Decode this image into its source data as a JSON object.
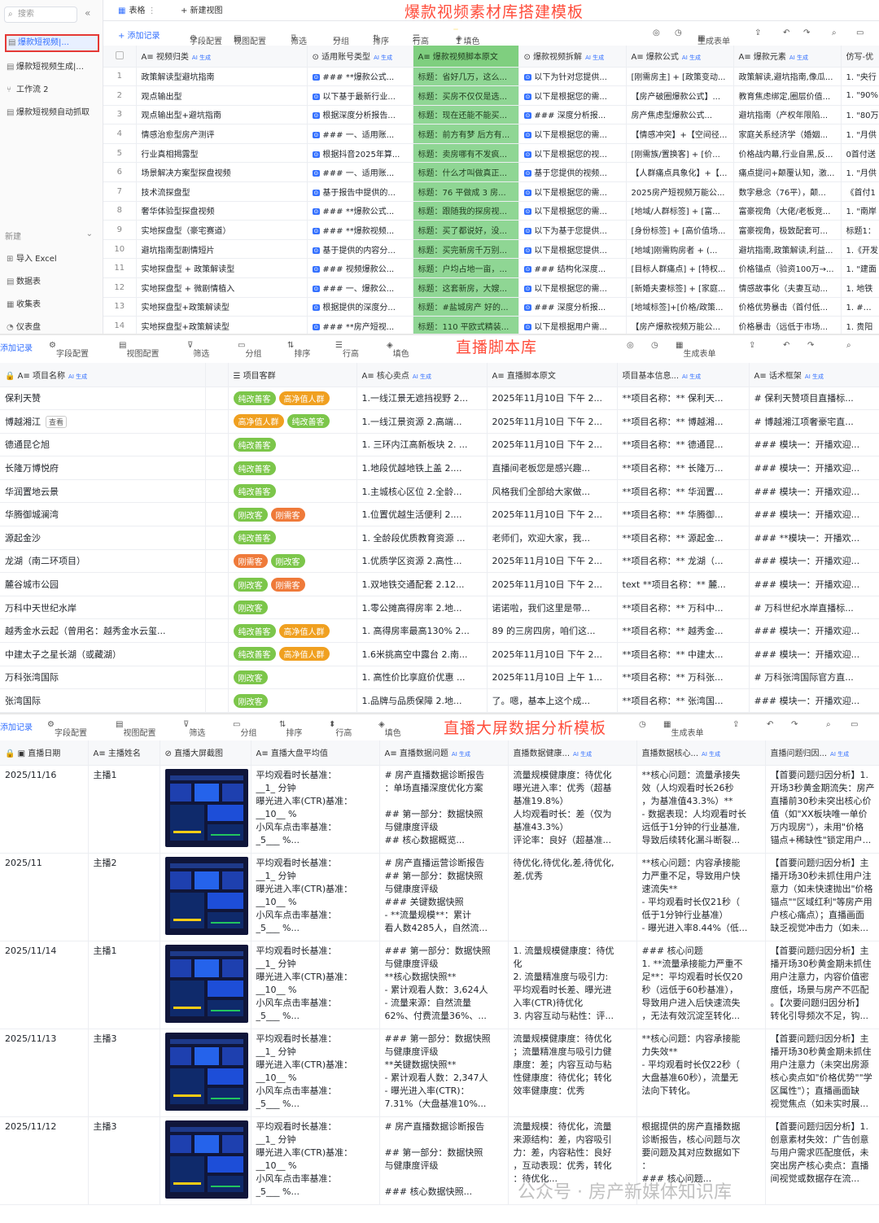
{
  "sidebar": {
    "search_placeholder": "搜索",
    "items": [
      "爆款短视频|...",
      "爆款短视频生成|...",
      "工作流 2",
      "爆款短视频自动抓取"
    ],
    "new_label": "新建",
    "actions": [
      "导入 Excel",
      "数据表",
      "收集表",
      "仪表盘"
    ]
  },
  "section1": {
    "title": "爆款视频素材库搭建模板",
    "tabs": [
      "表格",
      "+ 新建视图"
    ],
    "toolbar": [
      "+ 添加记录",
      "字段配置",
      "视图配置",
      "筛选",
      "分组",
      "排序",
      "行高",
      "1 填色",
      "生成表单"
    ],
    "headers": [
      "视频归类",
      "适用账号类型",
      "爆款视频脚本原文",
      "爆款视频拆解",
      "爆款公式",
      "爆款元素",
      "仿写-优"
    ],
    "rows": [
      [
        "1",
        "政策解读型避坑指南",
        "### **爆款公式...",
        "标题：省好几万，这么...",
        "以下为针对您提供...",
        "[刚需房主] + [政策变动...",
        "政策解读,避坑指南,像瓜...",
        "1. \"央行"
      ],
      [
        "2",
        "观点输出型",
        "以下基于最新行业...",
        "标题：买房不仅仅是选...",
        "以下是根据您的需...",
        "【房产破圈爆款公式】...",
        "教育焦虑绑定,圈层价值...",
        "1. \"90%"
      ],
      [
        "3",
        "观点输出型+避坑指南",
        "根据深度分析报告...",
        "标题：现在还能不能买...",
        "### 深度分析报...",
        "房产焦虑型爆款公式...",
        "避坑指南（产权年限陷...",
        "1. \"80万"
      ],
      [
        "4",
        "情感治愈型房产测评",
        "### 一、适用账...",
        "标题：前方有梦 后方有...",
        "以下是根据您的需...",
        "【情感冲突】+【空间径...",
        "家庭关系经济学（婚姻...",
        "1. \"月供"
      ],
      [
        "5",
        "行业真相揭露型",
        "根据抖音2025年算...",
        "标题：卖房哪有不发疯...",
        "以下是根据您的视...",
        "[刚需族/置换客] + [价...",
        "价格战内幕,行业自黑,反...",
        "0首付送"
      ],
      [
        "6",
        "场景解决方案型探盘视频",
        "### 一、适用账...",
        "标题：什么才叫做真正...",
        "基于您提供的视频...",
        "【人群痛点具象化】+【...",
        "痛点提问+颠覆认知，激...",
        "1. \"月供"
      ],
      [
        "7",
        "技术流探盘型",
        "基于报告中提供的...",
        "标题：76 平做成 3 房...",
        "以下是根据您的需...",
        "2025房产短视频万能公...",
        "数字悬念（76平），颠...",
        "《首付1"
      ],
      [
        "8",
        "奢华体验型探盘视频",
        "### **爆款公式...",
        "标题：跟随我的探房视...",
        "以下是根据您的需...",
        "[地域/人群标签] + [富...",
        "富豪视角（大佬/老板竞...",
        "1. \"南岸"
      ],
      [
        "9",
        "实地探盘型（豪宅赛道）",
        "### **爆款视频...",
        "标题：买了都说好，没...",
        "以下为基于您提供...",
        "[身份标签] + [高价值场...",
        "富豪视角，极致配套可...",
        "标题1："
      ],
      [
        "10",
        "避坑指南型剧情短片",
        "基于提供的内容分...",
        "标题：买完新房千万别...",
        "以下是根据您提供...",
        "[地域]刚需购房者 + (...",
        "避坑指南,政策解读,利益...",
        "1.《开发"
      ],
      [
        "11",
        "实地探盘型 + 政策解读型",
        "### 视频爆款公...",
        "标题：户均占地一亩，...",
        "### 结构化深度...",
        "[目标人群痛点] + [特权...",
        "价格锚点（验资100万→...",
        "1. \"建面"
      ],
      [
        "12",
        "实地探盘型 + 微剧情植入",
        "### 一、爆款公...",
        "标题：这套新房，大嫂...",
        "以下是根据您的需...",
        "[新婚夫妻标签] + [家庭...",
        "情感故事化（夫妻互动...",
        "1. 地铁"
      ],
      [
        "13",
        "实地探盘型+政策解读型",
        "根据提供的深度分...",
        "标题：#盐城房产 好的...",
        "### 深度分析报...",
        "[地域标签]+[价格/政策...",
        "价格优势暴击（首付低...",
        "1. #盐城"
      ],
      [
        "14",
        "实地探盘型+政策解读型",
        "### **房产短视...",
        "标题：110 平欧式精装...",
        "以下是根据用户需...",
        "【房产爆款视频万能公...",
        "价格暴击（远低于市场...",
        "1. 贵阳"
      ]
    ]
  },
  "section2": {
    "title": "直播脚本库",
    "toolbar": [
      "添加记录",
      "字段配置",
      "视图配置",
      "筛选",
      "分组",
      "排序",
      "行高",
      "填色",
      "生成表单"
    ],
    "headers": [
      "项目名称",
      "项目客群",
      "核心卖点",
      "直播脚本原文",
      "项目基本信息...",
      "话术框架"
    ],
    "view_label": "查看",
    "rows": [
      {
        "name": "保利天赞",
        "tags": [
          [
            "纯改善客",
            "g"
          ],
          [
            "高净值人群",
            "o"
          ]
        ],
        "point": "1.一线江景无遮挡视野 2...",
        "script": "2025年11月10日 下午 2...",
        "info": "**项目名称：** 保利天...",
        "frame": "# 保利天赞项目直播标..."
      },
      {
        "name": "博越湘江",
        "tags": [
          [
            "高净值人群",
            "o"
          ],
          [
            "纯改善客",
            "g"
          ]
        ],
        "point": "1.一线江景资源 2.高端...",
        "script": "2025年11月10日 下午 2...",
        "info": "**项目名称：** 博越湘...",
        "frame": "# 博越湘江项奢豪宅直..."
      },
      {
        "name": "德通昆仑旭",
        "tags": [
          [
            "纯改善客",
            "g"
          ]
        ],
        "point": "1. 三环内江高新板块 2. ...",
        "script": "2025年11月10日 下午 2...",
        "info": "**项目名称：** 德通昆...",
        "frame": "### 模块一：开播欢迎..."
      },
      {
        "name": "长隆万博悦府",
        "tags": [
          [
            "纯改善客",
            "g"
          ]
        ],
        "point": "1.地段优越地铁上盖 2....",
        "script": "直播间老板您是感兴趣...",
        "info": "**项目名称：** 长隆万...",
        "frame": "### 模块一：开播欢迎..."
      },
      {
        "name": "华润置地云景",
        "tags": [
          [
            "纯改善客",
            "g"
          ]
        ],
        "point": "1.主城核心区位 2.全龄...",
        "script": "风格我们全部给大家做...",
        "info": "**项目名称：** 华润置...",
        "frame": "### 模块一：开播欢迎..."
      },
      {
        "name": "华腾御城澜湾",
        "tags": [
          [
            "刚改客",
            "g"
          ],
          [
            "刚需客",
            "r"
          ]
        ],
        "point": "1.位置优越生活便利 2....",
        "script": "2025年11月10日 下午 2...",
        "info": "**项目名称：** 华腾御...",
        "frame": "### 模块一：开播欢迎..."
      },
      {
        "name": "源起金沙",
        "tags": [
          [
            "纯改善客",
            "g"
          ]
        ],
        "point": "1. 全龄段优质教育资源 ...",
        "script": "老师们，欢迎大家，我...",
        "info": "**项目名称：** 源起金...",
        "frame": "### **模块一：开播欢..."
      },
      {
        "name": "龙湖（南二环项目）",
        "tags": [
          [
            "刚需客",
            "r"
          ],
          [
            "刚改客",
            "g"
          ]
        ],
        "point": "1.优质学区资源 2.高性...",
        "script": "2025年11月10日 下午 2...",
        "info": "**项目名称：** 龙湖（...",
        "frame": "### 模块一：开播欢迎..."
      },
      {
        "name": "麓谷城市公园",
        "tags": [
          [
            "刚改客",
            "g"
          ],
          [
            "刚需客",
            "r"
          ]
        ],
        "point": "1.双地铁交通配套 2.12...",
        "script": "2025年11月10日 下午 2...",
        "info": "text **项目名称：** 麓...",
        "frame": "### 模块一：开播欢迎..."
      },
      {
        "name": "万科中天世纪水岸",
        "tags": [
          [
            "刚改客",
            "g"
          ]
        ],
        "point": "1.零公摊高得房率 2.地...",
        "script": "诺诺啦，我们这里是带...",
        "info": "**项目名称：** 万科中...",
        "frame": "# 万科世纪水岸直播标..."
      },
      {
        "name": "越秀金水云起（曾用名：越秀金水云玺...",
        "tags": [
          [
            "纯改善客",
            "g"
          ],
          [
            "高净值人群",
            "o"
          ]
        ],
        "point": "1. 高得房率最高130% 2...",
        "script": "89 的三房四房，咱们这...",
        "info": "**项目名称：** 越秀金...",
        "frame": "### 模块一：开播欢迎..."
      },
      {
        "name": "中建太子之星长湖（或藏湖）",
        "tags": [
          [
            "纯改善客",
            "g"
          ],
          [
            "高净值人群",
            "o"
          ]
        ],
        "point": "1.6米挑高空中露台 2.南...",
        "script": "2025年11月10日 下午 2...",
        "info": "**项目名称：** 中建太...",
        "frame": "### 模块一：开播欢迎..."
      },
      {
        "name": "万科张湾国际",
        "tags": [
          [
            "刚改客",
            "g"
          ]
        ],
        "point": "1. 高性价比享庭价优惠 ...",
        "script": "2025年11月10日 上午 1...",
        "info": "**项目名称：** 万科张...",
        "frame": "# 万科张湾国际官方直..."
      },
      {
        "name": "张湾国际",
        "tags": [
          [
            "刚改客",
            "g"
          ]
        ],
        "point": "1.品牌与品质保障 2.地...",
        "script": "了。嗯，基本上这个成...",
        "info": "**项目名称：** 张湾国...",
        "frame": "### 模块一：开播欢迎..."
      }
    ]
  },
  "section3": {
    "title": "直播大屏数据分析模板",
    "toolbar": [
      "添加记录",
      "字段配置",
      "视图配置",
      "筛选",
      "分组",
      "排序",
      "行高",
      "填色",
      "生成表单"
    ],
    "headers": [
      "直播日期",
      "主播姓名",
      "直播大屏截图",
      "直播大盘平均值",
      "直播数据问题",
      "直播数据健康...",
      "直播数据核心...",
      "直播问题归因..."
    ],
    "rows": [
      {
        "date": "2025/11/16",
        "host": "主播1",
        "avg": "平均观看时长基准：\n__1_ 分钟\n曝光进入率(CTR)基准：\n__10__ %\n小风车点击率基准：\n_5___ %...",
        "issue": "# 房产直播数据诊断报告\n：单场直播深度优化方案\n\n## 第一部分：数据快照\n与健康度评级\n## 核心数据概览...",
        "health": "流量规模健康度：待优化\n曝光进入率：优秀（超基\n基准19.8%）\n人均观看时长：差（仅为\n基准43.3%）\n评论率：良好（超基准...",
        "core": "**核心问题：流量承接失\n效（人均观看时长26秒\n，为基准值43.3%）**\n- 数据表现：人均观看时长\n远低于1分钟的行业基准,\n导致后续转化漏斗断裂...",
        "cause": "【首要问题归因分析】1.\n开场3秒黄金期流失：房产\n直播前30秒未突出核心价\n值（如\"XX板块唯一单价\n万内现房\"），未用\"价格\n锚点+稀缺性\"锁定用户..."
      },
      {
        "date": "2025/11",
        "host": "主播2",
        "avg": "平均观看时长基准：\n__1_ 分钟\n曝光进入率(CTR)基准：\n__10__ %\n小风车点击率基准：\n_5___ %...",
        "issue": "# 房产直播运营诊断报告\n## 第一部分：数据快照\n与健康度评级\n### 关键数据快照\n- **流量规模**：累计\n看人数4285人，自然流...",
        "health": "待优化,待优化,差,待优化,\n差,优秀",
        "core": "**核心问题：内容承接能\n力严重不足，导致用户快\n速流失**\n- 平均观看时长仅21秒（\n低于1分钟行业基准）\n- 曝光进入率8.44%（低...",
        "cause": "【首要问题归因分析】主\n播开场30秒未抓住用户注\n意力（如未快速抛出\"价格\n锚点\"\"区域红利\"等房产用\n户核心痛点）；直播画面\n缺乏视觉冲击力（如未..."
      },
      {
        "date": "2025/11/14",
        "host": "主播1",
        "avg": "平均观看时长基准：\n__1_ 分钟\n曝光进入率(CTR)基准：\n__10__ %\n小风车点击率基准：\n_5___ %...",
        "issue": "### 第一部分：数据快照\n与健康度评级\n**核心数据快照**\n- 累计观看人数：3,624人\n- 流量来源：自然流量\n62%、付费流量36%、...",
        "health": "1. 流量规模健康度：待优\n化\n2. 流量精准度与吸引力:\n平均观看时长差、曝光进\n入率(CTR)待优化\n3. 内容互动与粘性：评...",
        "core": "### 核心问题\n1. **流量承接能力严重不\n足**：平均观看时长仅20\n秒（远低于60秒基准），\n导致用户进入后快速流失\n，无法有效沉淀至转化...",
        "cause": "【首要问题归因分析】主\n播开场30秒黄金期未抓住\n用户注意力，内容价值密\n度低，场景与房产不匹配\n。【次要问题归因分析】\n转化引导频次不足，钩..."
      },
      {
        "date": "2025/11/13",
        "host": "主播3",
        "avg": "平均观看时长基准：\n__1_ 分钟\n曝光进入率(CTR)基准：\n__10__ %\n小风车点击率基准：\n_5___ %...",
        "issue": "### 第一部分：数据快照\n与健康度评级\n**关键数据快照**\n- 累计观看人数：2,347人\n- 曝光进入率(CTR)：\n7.31%（大盘基准10%...",
        "health": "流量规模健康度：待优化\n；流量精准度与吸引力健\n康度：差；内容互动与粘\n性健康度：待优化；转化\n效率健康度：优秀",
        "core": "**核心问题：内容承接能\n力失效**\n- 平均观看时长仅22秒（\n大盘基准60秒），流量无\n法向下转化。",
        "cause": "【首要问题归因分析】主\n播开场30秒黄金期未抓住\n用户注意力（未突出房源\n核心卖点如\"价格优势\"\"学\n区属性\"）；直播画面缺\n视觉焦点（如未实时展..."
      },
      {
        "date": "2025/11/12",
        "host": "主播3",
        "avg": "平均观看时长基准：\n__1_ 分钟\n曝光进入率(CTR)基准：\n__10__ %\n小风车点击率基准：\n_5___ %...",
        "issue": "# 房产直播数据诊断报告\n\n## 第一部分：数据快照\n与健康度评级\n\n### 核心数据快照...",
        "health": "流量规模：待优化，流量\n来源结构：差，内容吸引\n力：差，内容粘性：良好\n，互动表现：优秀，转化\n：待优化...",
        "core": "根据提供的房产直播数据\n诊断报告，核心问题与次\n要问题及其对应数据如下\n：\n### 核心问题...",
        "cause": "【首要问题归因分析】1.\n创意素材失效：广告创意\n与用户需求匹配度低，未\n突出房产核心卖点：直播\n间视觉或数据存在流..."
      }
    ]
  },
  "watermark": "公众号 · 房产新媒体知识库"
}
